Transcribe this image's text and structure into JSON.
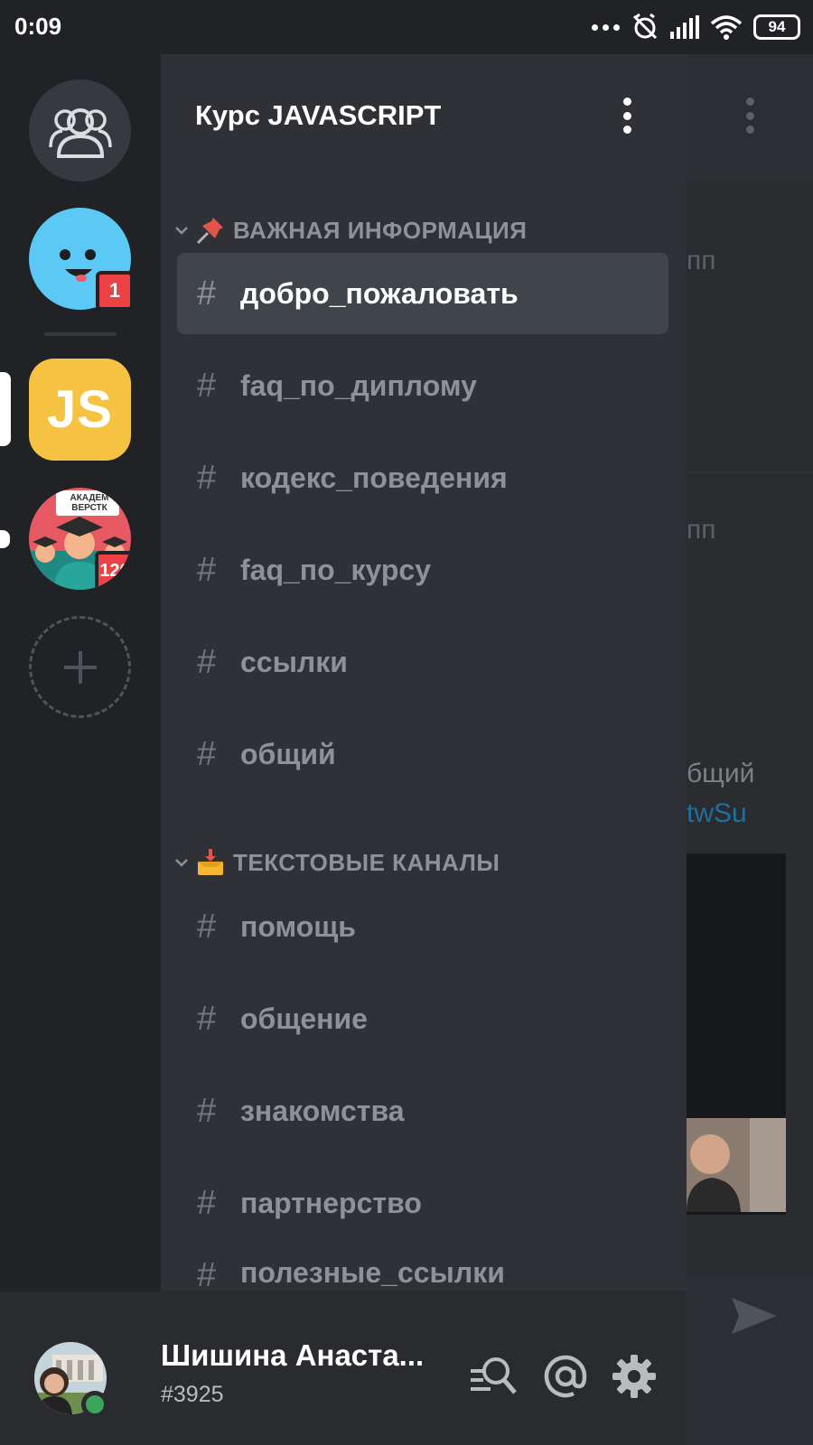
{
  "status_bar": {
    "time": "0:09",
    "battery": "94"
  },
  "servers": {
    "bot_badge": "1",
    "js_label": "JS",
    "academy_text": "АКАДЕМ ВЕРСТК",
    "academy_badge": "120"
  },
  "guild": {
    "name": "Курс JAVASCRIPT"
  },
  "categories": [
    {
      "label": "ВАЖНАЯ ИНФОРМАЦИЯ",
      "channels": [
        {
          "name": "добро_пожаловать",
          "selected": true
        },
        {
          "name": "faq_по_диплому"
        },
        {
          "name": "кодекс_поведения"
        },
        {
          "name": "faq_по_курсу"
        },
        {
          "name": "ссылки"
        },
        {
          "name": "общий"
        }
      ]
    },
    {
      "label": "ТЕКСТОВЫЕ КАНАЛЫ",
      "channels": [
        {
          "name": "помощь"
        },
        {
          "name": "общение"
        },
        {
          "name": "знакомства"
        },
        {
          "name": "партнерство"
        },
        {
          "name": "полезные_ссылки"
        }
      ]
    }
  ],
  "channel_hash": "#",
  "chat_fragments": {
    "frag1": "пп",
    "frag2": "пп",
    "frag3": "бщий",
    "frag4": "twSu"
  },
  "user": {
    "name": "Шишина Анаста...",
    "tag": "#3925"
  },
  "colors": {
    "accent_online": "#3ba55c",
    "badge_red": "#ed4245",
    "js_yellow": "#f5c242",
    "link_blue": "#1c6fa0"
  }
}
